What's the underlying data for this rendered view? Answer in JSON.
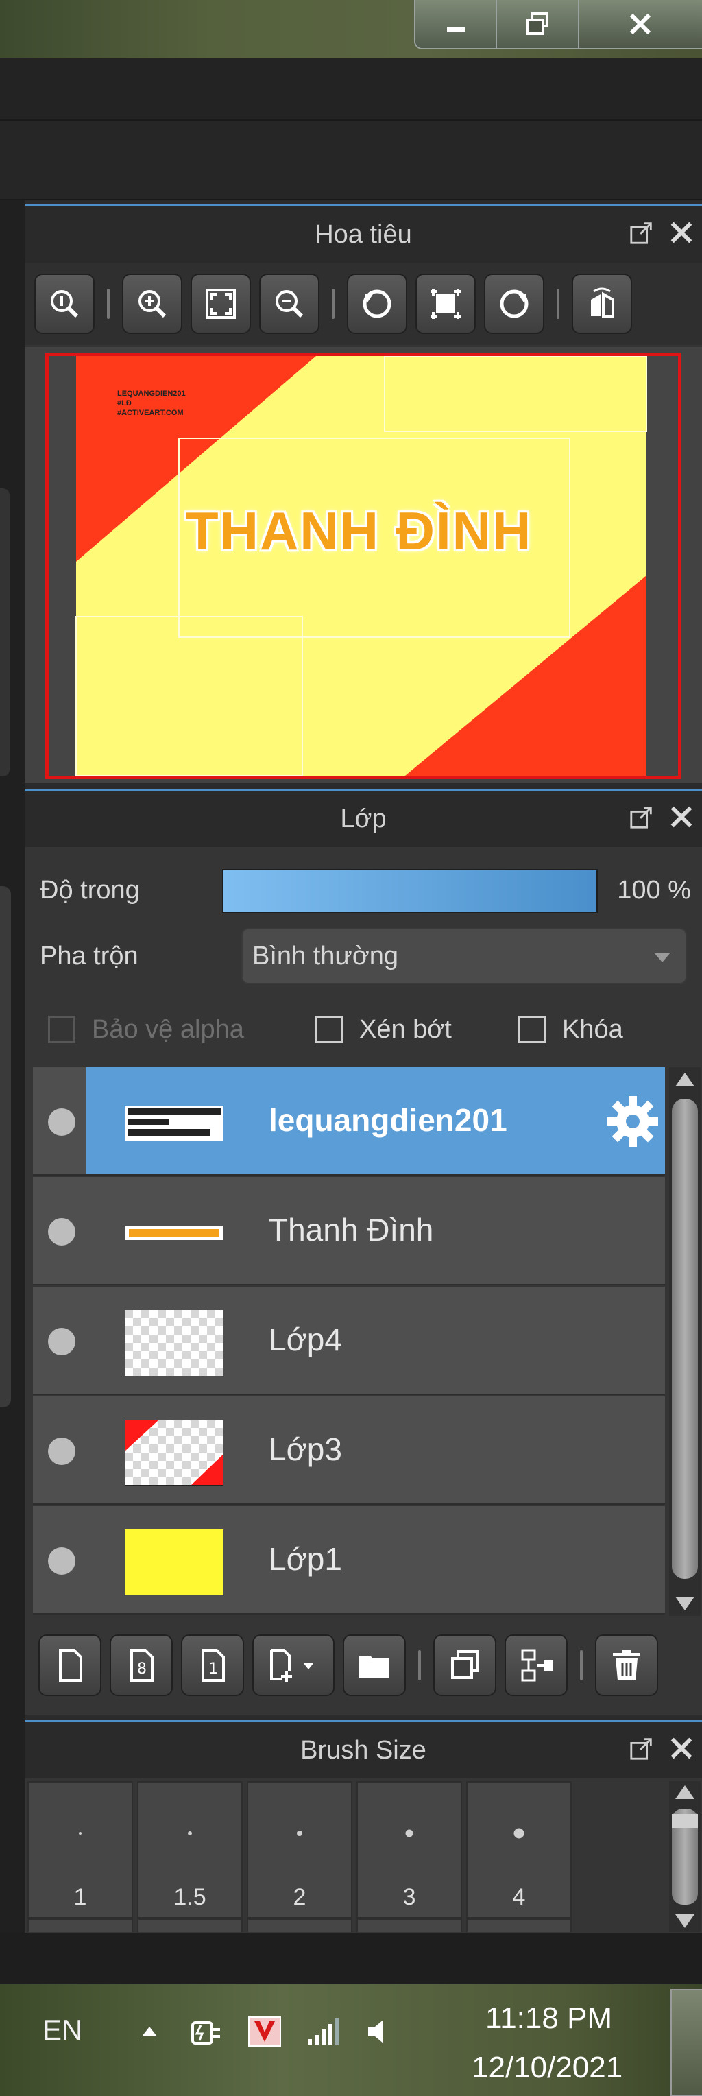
{
  "navigator": {
    "title": "Hoa tiêu",
    "preview_text": "THANH ĐÌNH",
    "preview_watermark": [
      "LEQUANGDIEN201",
      "#LĐ",
      "#ACTIVEART.COM"
    ],
    "accent_border": "#e01414"
  },
  "layers": {
    "title": "Lớp",
    "opacity_label": "Độ trong",
    "opacity_value": "100 %",
    "opacity_fraction": 1.0,
    "blend_label": "Pha trộn",
    "blend_value": "Bình thường",
    "protect_alpha_label": "Bảo vệ alpha",
    "clip_label": "Xén bớt",
    "lock_label": "Khóa",
    "items": [
      {
        "name": "lequangdien201",
        "selected": true,
        "thumb": "watermark"
      },
      {
        "name": "Thanh Đình",
        "selected": false,
        "thumb": "text"
      },
      {
        "name": "Lớp4",
        "selected": false,
        "thumb": "transparent"
      },
      {
        "name": "Lớp3",
        "selected": false,
        "thumb": "red-corners"
      },
      {
        "name": "Lớp1",
        "selected": false,
        "thumb": "yellow"
      }
    ]
  },
  "brush": {
    "title": "Brush Size",
    "sizes": [
      "1",
      "1.5",
      "2",
      "3",
      "4"
    ]
  },
  "taskbar": {
    "language": "EN",
    "time": "11:18 PM",
    "date": "12/10/2021"
  },
  "colors": {
    "accent": "#4d90c9",
    "selection": "#5b9dd6",
    "canvas_red": "#ff3a1a",
    "canvas_yellow": "#fffa78"
  }
}
